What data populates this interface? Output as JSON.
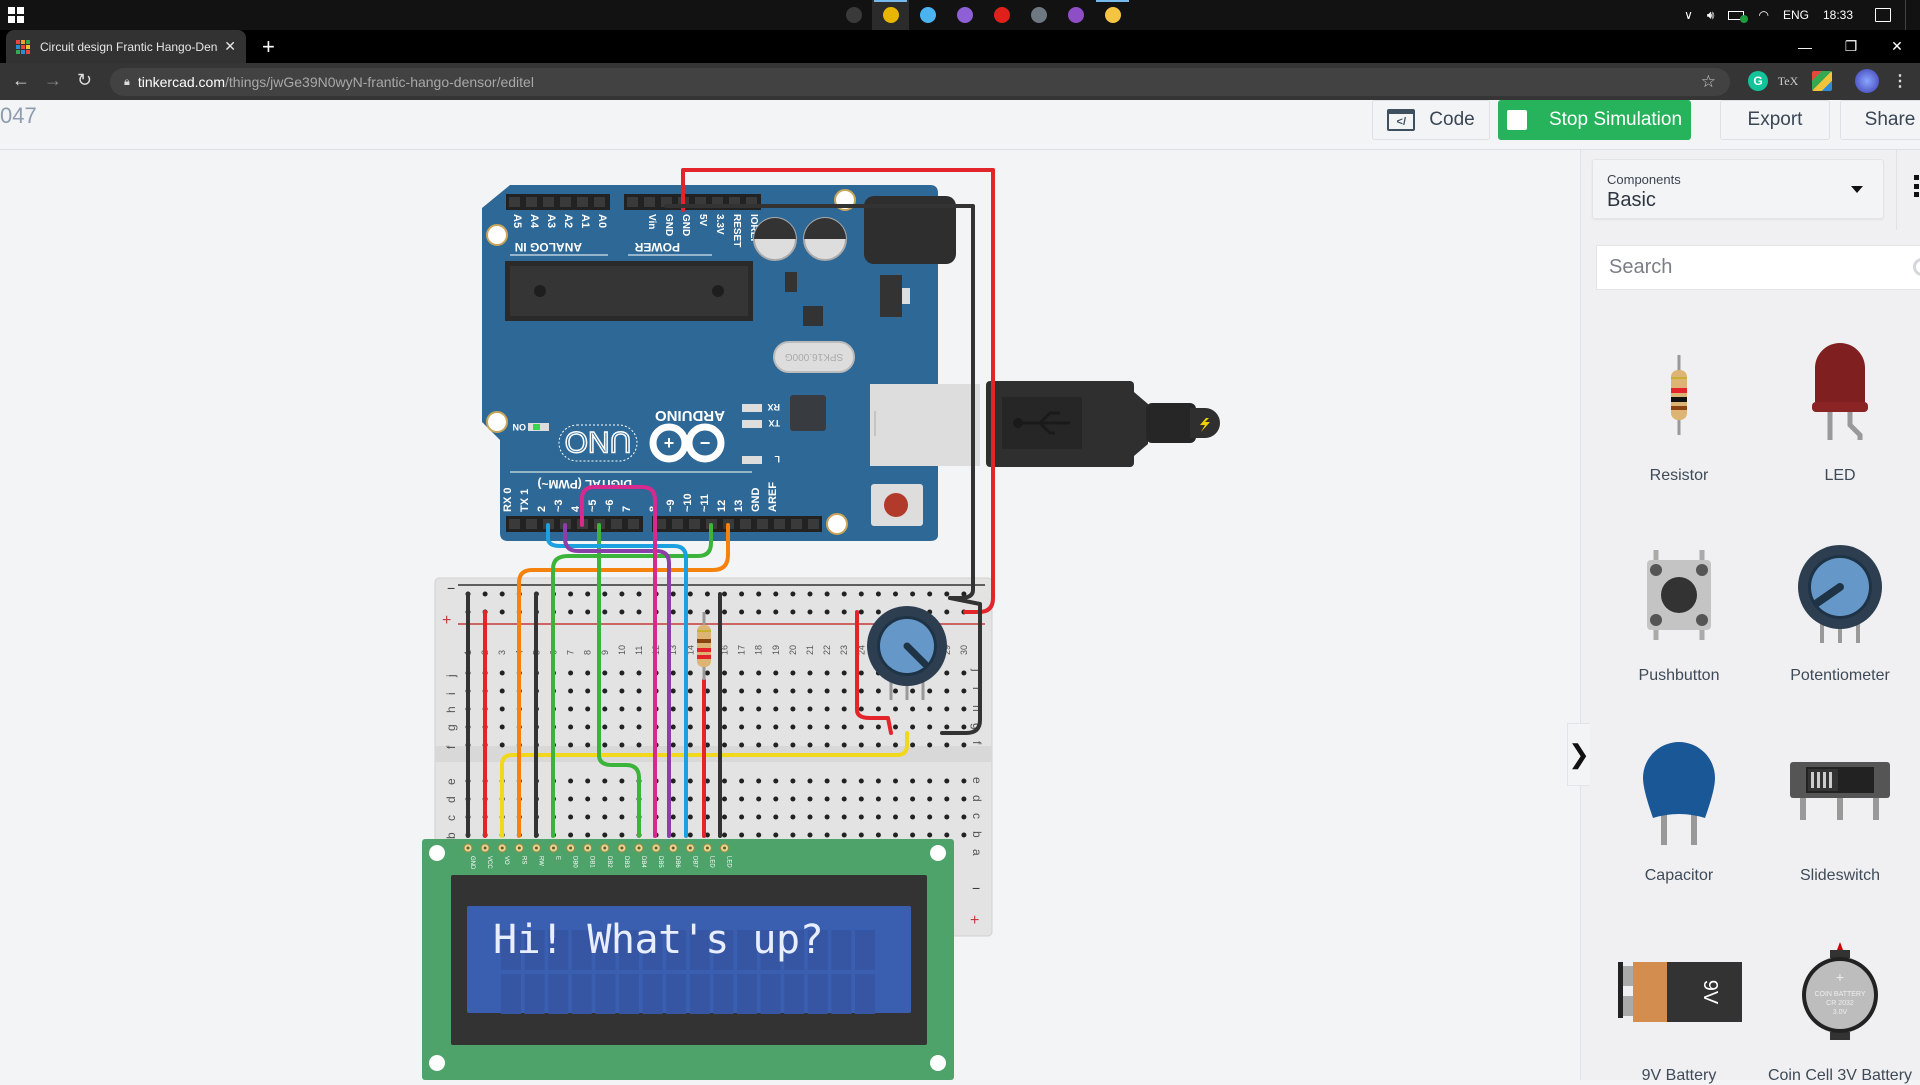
{
  "taskbar": {
    "apps": [
      {
        "name": "unreal-engine-icon",
        "color": "#3a3a3a"
      },
      {
        "name": "chrome-icon",
        "color": "#e8b600",
        "active": true
      },
      {
        "name": "remote-desktop-icon",
        "color": "#4ab3f0"
      },
      {
        "name": "visual-studio-icon",
        "color": "#8f5fd6"
      },
      {
        "name": "screen-recorder-icon",
        "color": "#e0201a"
      },
      {
        "name": "file-manager-icon",
        "color": "#6d7883"
      },
      {
        "name": "purple-app-icon",
        "color": "#8e4ec6"
      },
      {
        "name": "file-explorer-icon",
        "color": "#f5c542",
        "running": true
      }
    ],
    "tray": {
      "language": "ENG",
      "time": "18:33"
    }
  },
  "browser": {
    "tab_title": "Circuit design Frantic Hango-Densor",
    "tab_close": "✕",
    "new_tab": "+",
    "url_host": "tinkercad.com",
    "url_path": "/things/jwGe39N0wyN-frantic-hango-densor/editel",
    "window_controls": {
      "minimize": "—",
      "restore": "❐",
      "close": "✕"
    }
  },
  "toolbar": {
    "design_id": "047",
    "code_label": "Code",
    "stop_label": "Stop Simulation",
    "export_label": "Export",
    "share_label": "Share"
  },
  "panel": {
    "select_label": "Components",
    "select_value": "Basic",
    "search_placeholder": "Search",
    "components": [
      {
        "name": "Resistor"
      },
      {
        "name": "LED"
      },
      {
        "name": "Pushbutton"
      },
      {
        "name": "Potentiometer"
      },
      {
        "name": "Capacitor"
      },
      {
        "name": "Slideswitch"
      },
      {
        "name": "9V Battery",
        "text": "9V"
      },
      {
        "name": "Coin Cell 3V Battery",
        "text": "COIN BATTERY CR 2032 3.0V"
      }
    ],
    "collapse_icon": "❯"
  },
  "circuit": {
    "arduino": {
      "brand": "ARDUINO",
      "model": "UNO",
      "on_label": "ON",
      "analog_label": "ANALOG IN",
      "power_label": "POWER",
      "digital_label": "DIGITAL (PWM~)",
      "crystal": "SPK16.000G",
      "analog_pins": [
        "A5",
        "A4",
        "A3",
        "A2",
        "A1",
        "A0"
      ],
      "power_pins": [
        "Vin",
        "GND",
        "GND",
        "5V",
        "3.3V",
        "RESET",
        "IOREF"
      ],
      "digital_pins": [
        "RX 0",
        "TX 1",
        "2",
        "~3",
        "4",
        "~5",
        "~6",
        "7",
        "8",
        "~9",
        "~10",
        "~11",
        "12",
        "13",
        "GND",
        "AREF"
      ],
      "leds": [
        "RX",
        "TX",
        "L"
      ]
    },
    "breadboard": {
      "row_letters_top": [
        "j",
        "i",
        "h",
        "g",
        "f"
      ],
      "row_letters_bottom": [
        "e",
        "d",
        "c",
        "b",
        "a"
      ],
      "columns": 30,
      "minus": "−",
      "plus": "+"
    },
    "lcd": {
      "pins": [
        "GND",
        "VCC",
        "VO",
        "RS",
        "RW",
        "E",
        "DB0",
        "DB1",
        "DB2",
        "DB3",
        "DB4",
        "DB5",
        "DB6",
        "DB7",
        "LED",
        "LED"
      ],
      "line1": "Hi! What's up?",
      "line2": ""
    },
    "wire_colors": {
      "red": "#e3242b",
      "black": "#333333",
      "orange": "#f5820d",
      "green": "#3cb43c",
      "blue": "#1ca0e0",
      "purple": "#8b3fa8",
      "magenta": "#d62a8e",
      "yellow": "#f2d81c"
    }
  },
  "colors": {
    "accent_green": "#26b35b",
    "arduino_blue": "#2e6896",
    "lcd_green": "#4ea36a",
    "lcd_screen": "#3a5fb0"
  }
}
